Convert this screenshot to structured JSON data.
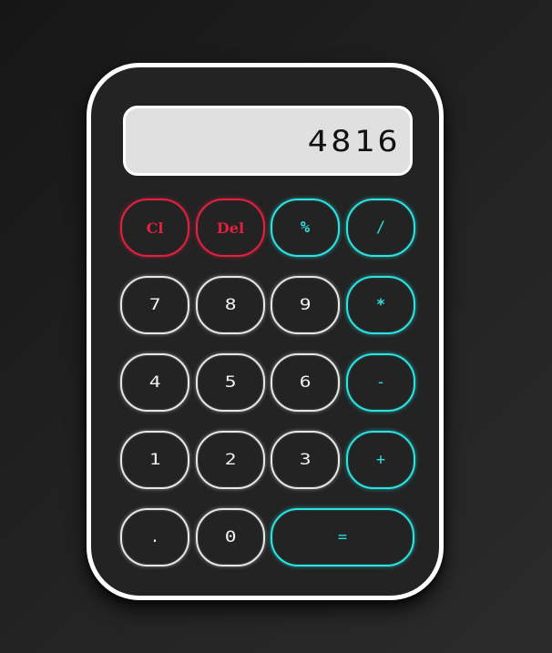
{
  "display": {
    "value": "4816"
  },
  "buttons": {
    "clear": "Cl",
    "delete": "Del",
    "percent": "%",
    "divide": "/",
    "seven": "7",
    "eight": "8",
    "nine": "9",
    "multiply": "*",
    "four": "4",
    "five": "5",
    "six": "6",
    "subtract": "-",
    "one": "1",
    "two": "2",
    "three": "3",
    "add": "+",
    "decimal": ".",
    "zero": "0",
    "equals": "="
  },
  "colors": {
    "function_accent": "#e0213f",
    "operator_accent": "#2be3e3",
    "digit_accent": "#e6e6e6",
    "display_background": "#e0e0e0",
    "body_background": "#232323"
  }
}
